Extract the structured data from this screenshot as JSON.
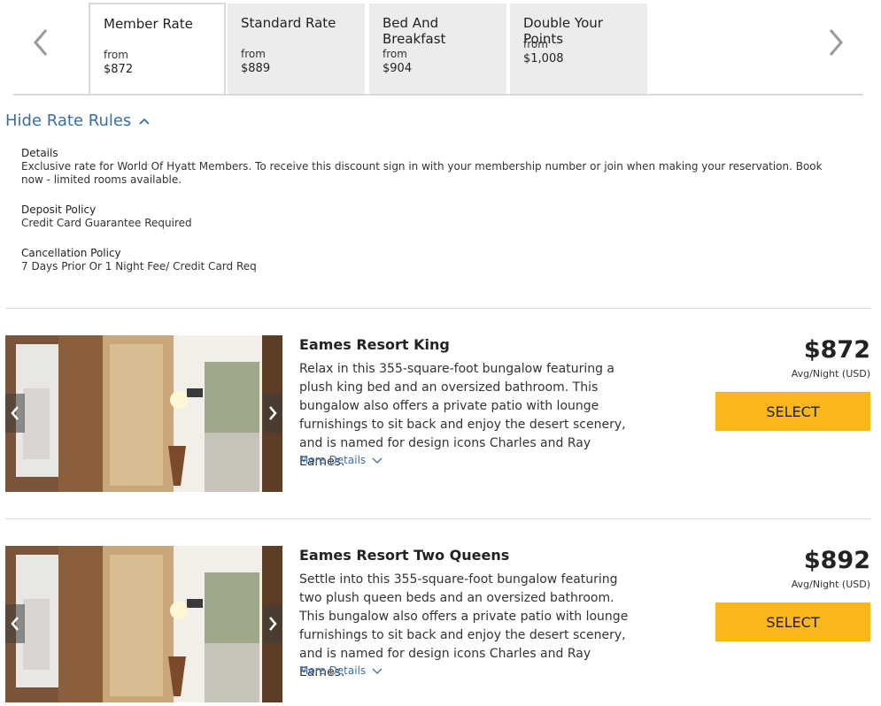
{
  "rate_tabs": [
    {
      "name": "Member Rate",
      "from": "from",
      "price": "$872"
    },
    {
      "name": "Standard Rate",
      "from": "from",
      "price": "$889"
    },
    {
      "name": "Bed And Breakfast",
      "from": "from",
      "price": "$904"
    },
    {
      "name": "Double Your Points",
      "from": "from",
      "price": "$1,008"
    }
  ],
  "hide_rules_label": "Hide Rate Rules",
  "rules": {
    "details_title": "Details",
    "details_text": "Exclusive rate for World Of Hyatt Members. To receive this discount sign in with your membership number or join when making your reservation. Book now - limited rooms available.",
    "deposit_title": "Deposit Policy",
    "deposit_text": "Credit Card Guarantee Required",
    "cancellation_title": "Cancellation Policy",
    "cancellation_text": "7 Days Prior Or 1 Night Fee/ Credit Card Req"
  },
  "rooms": [
    {
      "title": "Eames Resort King",
      "description": "Relax in this 355-square-foot bungalow featuring a plush king bed and an oversized bathroom. This bungalow also offers a private patio with lounge furnishings to sit back and enjoy the desert scenery, and is named for design icons Charles and Ray Eames.",
      "more_details": "More Details",
      "price": "$872",
      "price_note": "Avg/Night (USD)",
      "select_label": "SELECT"
    },
    {
      "title": "Eames Resort Two Queens",
      "description": "Settle into this 355-square-foot bungalow featuring two plush queen beds and an oversized bathroom. This bungalow also offers a private patio with lounge furnishings to sit back and enjoy the desert scenery, and is named for design icons Charles and Ray Eames.",
      "more_details": "More Details",
      "price": "$892",
      "price_note": "Avg/Night (USD)",
      "select_label": "SELECT"
    }
  ],
  "icons": {
    "prev": "chevron-left-icon",
    "next": "chevron-right-icon",
    "collapse": "chevron-up-icon",
    "expand": "chevron-down-icon"
  },
  "colors": {
    "link": "#3a6ea5",
    "select_button": "#fbb719",
    "tab_inactive": "#ececec"
  }
}
